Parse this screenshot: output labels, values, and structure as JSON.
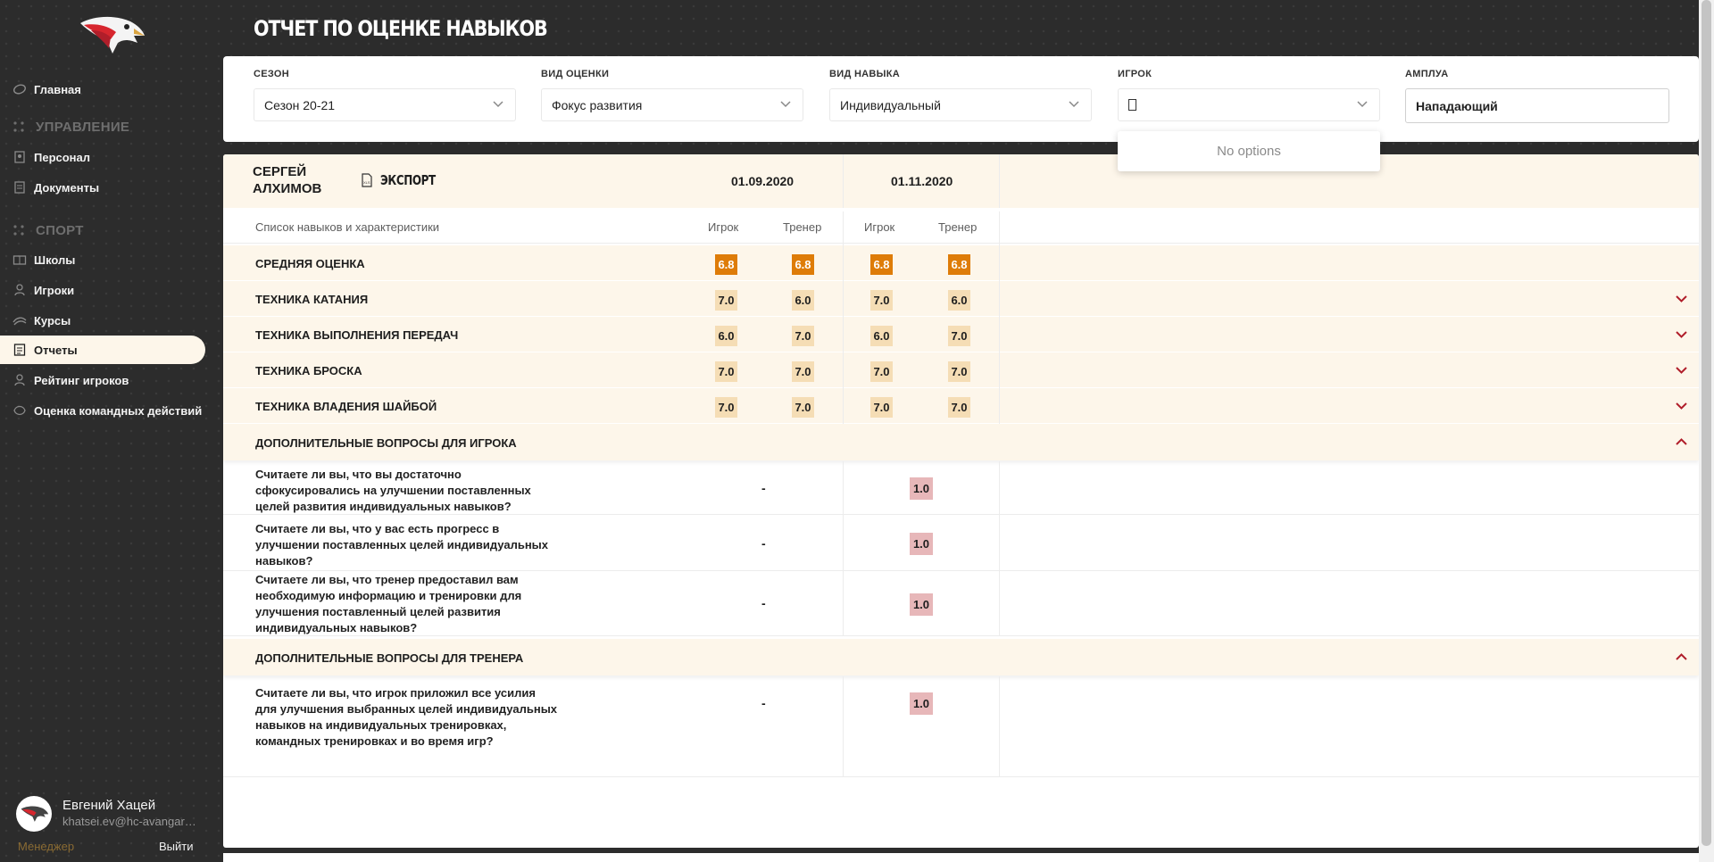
{
  "app": {
    "page_title": "ОТЧЕТ ПО ОЦЕНКЕ НАВЫКОВ"
  },
  "sidebar": {
    "items": [
      {
        "label": "Главная",
        "icon": "home-icon"
      },
      {
        "section": "УПРАВЛЕНИЕ"
      },
      {
        "label": "Персонал",
        "icon": "staff-icon"
      },
      {
        "label": "Документы",
        "icon": "document-icon"
      },
      {
        "section": "СПОРТ"
      },
      {
        "label": "Школы",
        "icon": "school-icon"
      },
      {
        "label": "Игроки",
        "icon": "player-icon"
      },
      {
        "label": "Курсы",
        "icon": "courses-icon"
      },
      {
        "label": "Отчеты",
        "icon": "reports-icon",
        "active": true
      },
      {
        "label": "Рейтинг игроков",
        "icon": "rating-icon"
      },
      {
        "label": "Оценка командных действий",
        "icon": "team-icon"
      }
    ],
    "user": {
      "name": "Евгений Хацей",
      "email": "khatsei.ev@hc-avangard...",
      "role": "Менеджер",
      "logout": "Выйти"
    }
  },
  "filters": {
    "season": {
      "label": "СЕЗОН",
      "value": "Сезон 20-21"
    },
    "assessment": {
      "label": "ВИД ОЦЕНКИ",
      "value": "Фокус развития"
    },
    "skill_type": {
      "label": "ВИД НАВЫКА",
      "value": "Индивидуальный"
    },
    "player": {
      "label": "ИГРОК",
      "value": "",
      "no_options": "No options"
    },
    "position": {
      "label": "АМПЛУА",
      "value": "Нападающий"
    }
  },
  "report": {
    "player_name": "СЕРГЕЙ АЛХИМОВ",
    "export_label": "ЭКСПОРТ",
    "dates": [
      "01.09.2020",
      "01.11.2020"
    ],
    "list_header": "Список навыков и характеристики",
    "col_player": "Игрок",
    "col_coach": "Тренер",
    "skills": [
      {
        "name": "СРЕДНЯЯ ОЦЕНКА",
        "scores": [
          "6.8",
          "6.8",
          "6.8",
          "6.8"
        ],
        "average": true
      },
      {
        "name": "ТЕХНИКА КАТАНИЯ",
        "scores": [
          "7.0",
          "6.0",
          "7.0",
          "6.0"
        ]
      },
      {
        "name": "ТЕХНИКА ВЫПОЛНЕНИЯ ПЕРЕДАЧ",
        "scores": [
          "6.0",
          "7.0",
          "6.0",
          "7.0"
        ]
      },
      {
        "name": "ТЕХНИКА БРОСКА",
        "scores": [
          "7.0",
          "7.0",
          "7.0",
          "7.0"
        ]
      },
      {
        "name": "ТЕХНИКА ВЛАДЕНИЯ ШАЙБОЙ",
        "scores": [
          "7.0",
          "7.0",
          "7.0",
          "7.0"
        ]
      }
    ],
    "player_questions": {
      "title": "ДОПОЛНИТЕЛЬНЫЕ ВОПРОСЫ ДЛЯ ИГРОКА",
      "items": [
        {
          "text": "Считаете ли вы, что вы достаточно сфокусировались на улучшении поставленных целей развития индивидуальных навыков?",
          "first": "-",
          "second": "1.0"
        },
        {
          "text": "Считаете ли вы, что у вас есть прогресс в улучшении поставленных целей индивидуальных навыков?",
          "first": "-",
          "second": "1.0"
        },
        {
          "text": "Считаете ли вы, что тренер предоставил вам необходимую информацию и тренировки для улучшения поставленный целей развития индивидуальных навыков?",
          "first": "-",
          "second": "1.0"
        }
      ]
    },
    "coach_questions": {
      "title": "ДОПОЛНИТЕЛЬНЫЕ ВОПРОСЫ ДЛЯ ТРЕНЕРА",
      "items": [
        {
          "text": "Считаете ли вы, что игрок приложил все усилия для улучшения выбранных целей индивидуальных навыков на индивидуальных тренировках, командных тренировках и во время игр?",
          "first": "-",
          "second": "1.0"
        }
      ]
    }
  },
  "colors": {
    "accent": "#de7c08",
    "cream": "#fdf6ea",
    "score_bg": "#f5ddb5",
    "question_score_bg": "#e7b7b9",
    "arrow": "#b01e2a"
  }
}
